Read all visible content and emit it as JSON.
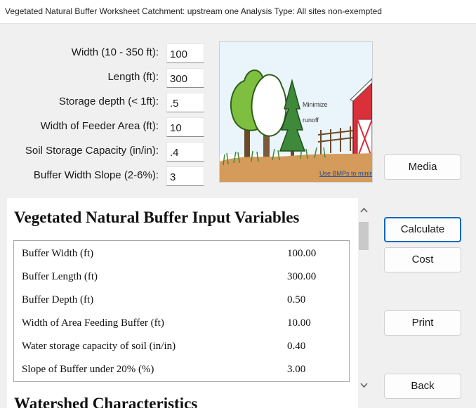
{
  "window": {
    "title": "Vegetated Natural Buffer Worksheet Catchment: upstream one Analysis Type: All sites non-exempted"
  },
  "form": {
    "fields": [
      {
        "label": "Width (10 - 350 ft):",
        "value": "100"
      },
      {
        "label": "Length (ft):",
        "value": "300"
      },
      {
        "label": "Storage depth (< 1ft):",
        "value": ".5"
      },
      {
        "label": "Width of Feeder Area (ft):",
        "value": "10"
      },
      {
        "label": "Soil Storage Capacity (in/in):",
        "value": ".4"
      },
      {
        "label": "Buffer Width Slope (2-6%):",
        "value": "3"
      }
    ]
  },
  "illustration": {
    "caption_1": "Minimize",
    "caption_2": "runoff",
    "caption_3": "Use BMPs to minimize"
  },
  "buttons": {
    "media": "Media",
    "calculate": "Calculate",
    "cost": "Cost",
    "print": "Print",
    "back": "Back"
  },
  "report": {
    "heading": "Vegetated Natural Buffer Input Variables",
    "rows": [
      {
        "label": "Buffer Width (ft)",
        "value": "100.00"
      },
      {
        "label": "Buffer Length (ft)",
        "value": "300.00"
      },
      {
        "label": "Buffer Depth (ft)",
        "value": "0.50"
      },
      {
        "label": "Width of Area Feeding Buffer (ft)",
        "value": "10.00"
      },
      {
        "label": "Water storage capacity of soil (in/in)",
        "value": "0.40"
      },
      {
        "label": "Slope of Buffer under 20% (%)",
        "value": "3.00"
      }
    ],
    "next_heading": "Watershed Characteristics"
  },
  "colors": {
    "accent": "#0067c0",
    "barn": "#d9303a",
    "tree": "#7fbf3f",
    "sky": "#1f9bd6"
  }
}
